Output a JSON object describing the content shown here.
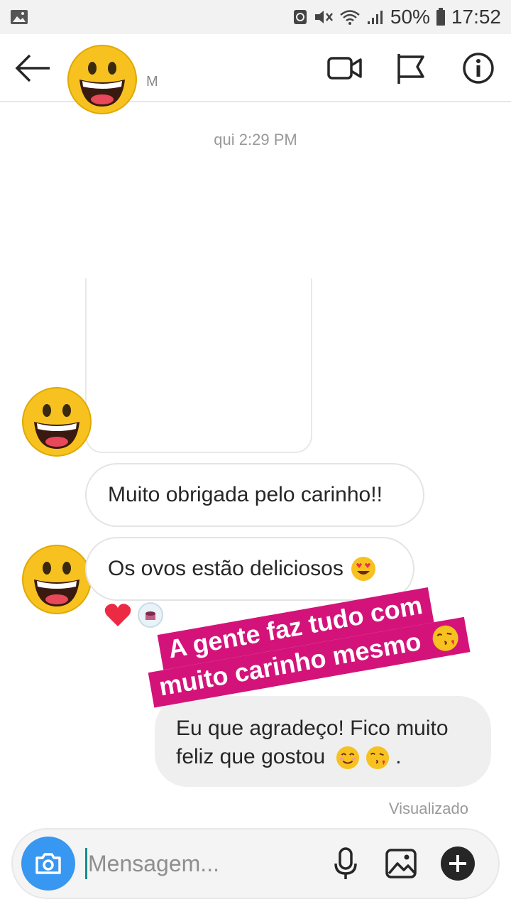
{
  "status_bar": {
    "battery": "50%",
    "time": "17:52"
  },
  "header": {
    "contact_name": "M"
  },
  "chat": {
    "timestamp": "qui 2:29 PM",
    "messages_in": [
      {
        "text": "Muito obrigada pelo carinho!!"
      },
      {
        "text": "Os ovos estão deliciosos"
      }
    ],
    "message_out_line1": "Eu que agradeço! Fico muito",
    "message_out_line2": "feliz que gostou",
    "message_out_end": ".",
    "seen_label": "Visualizado"
  },
  "sticker": {
    "line1": "A gente faz tudo com",
    "line2": "muito carinho mesmo"
  },
  "composer": {
    "placeholder": "Mensagem..."
  },
  "colors": {
    "accent_blue": "#3897f0",
    "sticker_pink": "#d4137a",
    "emoji_yellow": "#f7c21f"
  }
}
